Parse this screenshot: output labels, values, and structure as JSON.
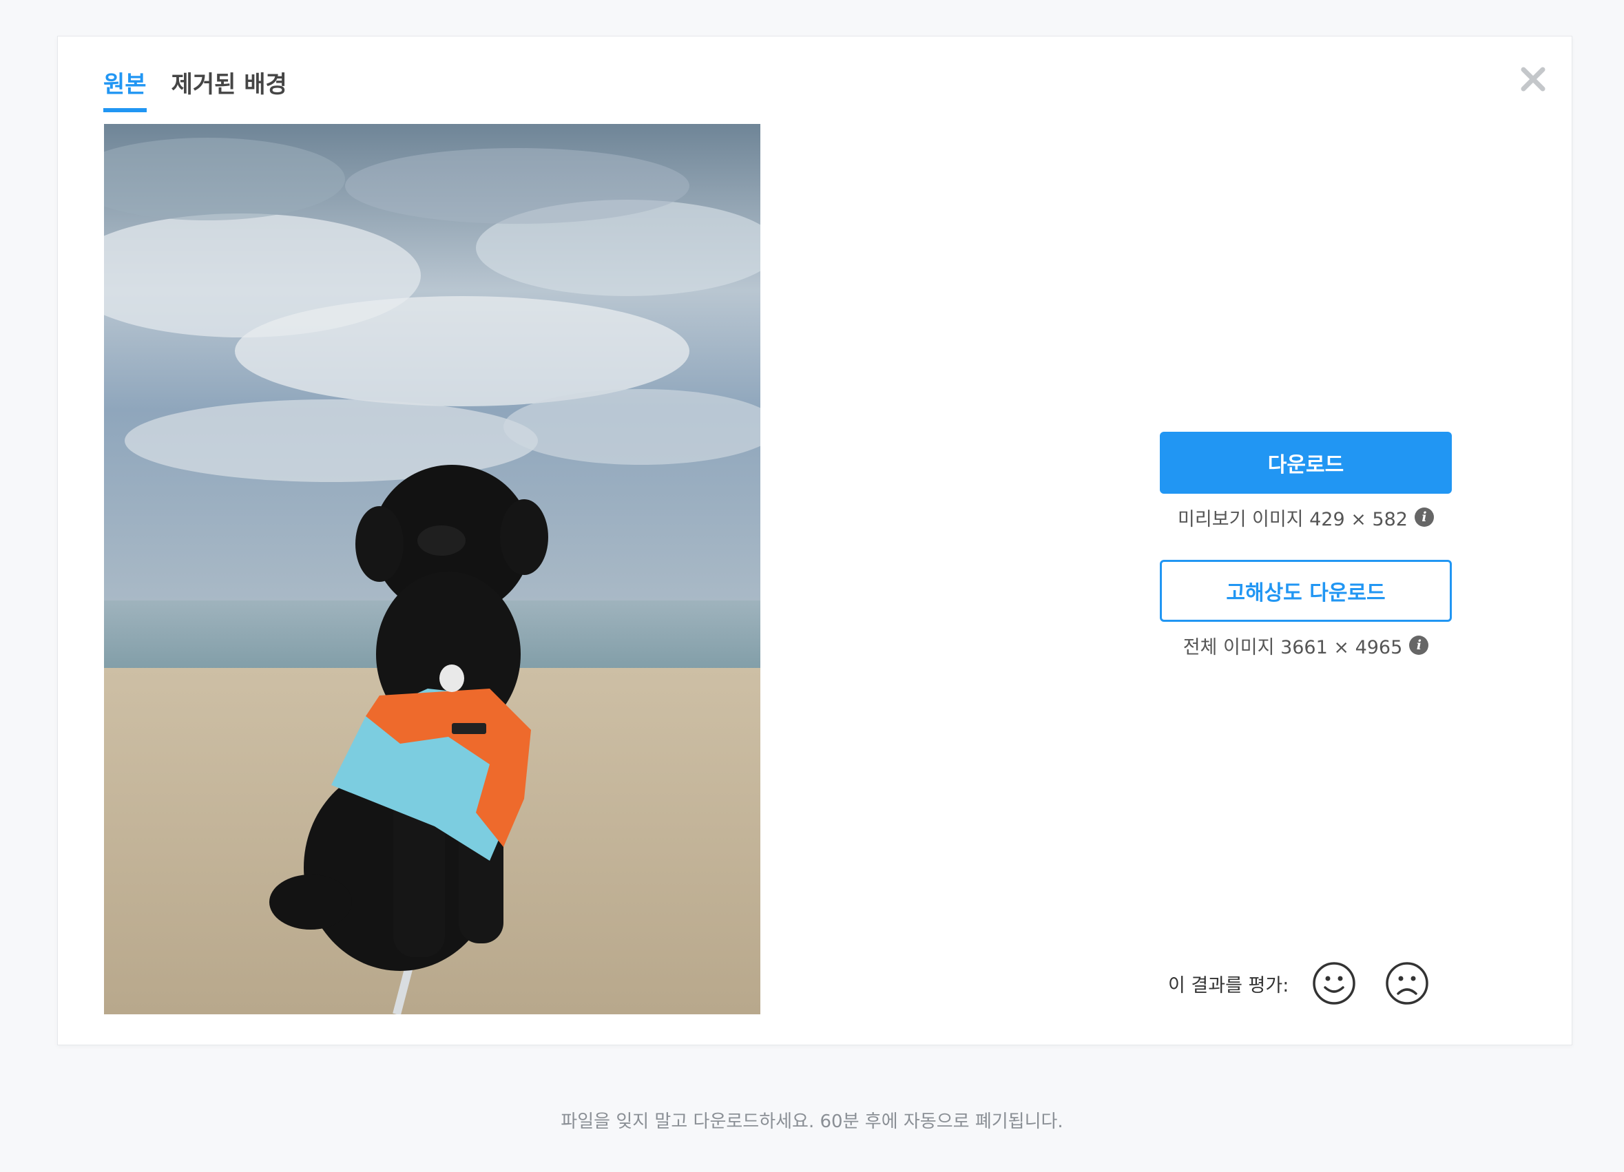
{
  "tabs": [
    {
      "label": "원본",
      "active": true
    },
    {
      "label": "제거된 배경",
      "active": false
    }
  ],
  "close_icon": "close-icon",
  "preview_image": {
    "subject": "dog-on-beach-photo"
  },
  "download": {
    "button_label": "다운로드",
    "meta_label": "미리보기 이미지 429 × 582"
  },
  "hd_download": {
    "button_label": "고해상도 다운로드",
    "meta_label": "전체 이미지 3661 × 4965"
  },
  "rating": {
    "label": "이 결과를 평가:",
    "positive_icon": "smile-icon",
    "negative_icon": "frown-icon"
  },
  "footer": {
    "text": "파일을 잊지 말고 다운로드하세요. 60분 후에 자동으로 폐기됩니다."
  },
  "colors": {
    "accent": "#2196f3",
    "background": "#f7f8fa"
  }
}
